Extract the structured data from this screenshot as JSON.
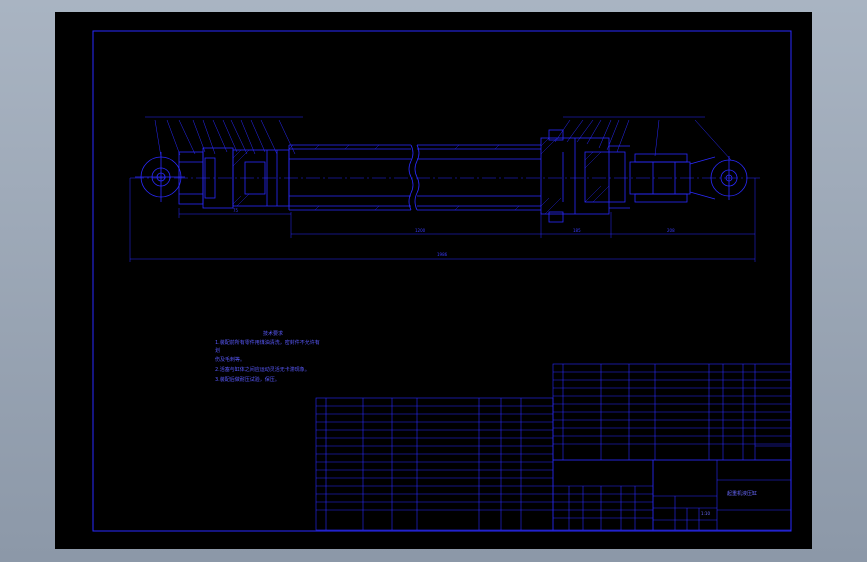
{
  "drawing": {
    "title_block_name": "起重机液压缸",
    "scale": "1:10"
  },
  "technical_requirements": {
    "heading": "技术要求",
    "lines": [
      "1.装配前所有零件用煤油清洗，密封件不允许有",
      "划",
      "   伤及毛刺等。",
      "2.活塞与缸体之间应运动灵活无卡滞现象。",
      "3.装配后做耐压试验，保压。"
    ]
  },
  "colors": {
    "background": "#000000",
    "line": "#2a2aff",
    "text": "#5a5aff"
  }
}
